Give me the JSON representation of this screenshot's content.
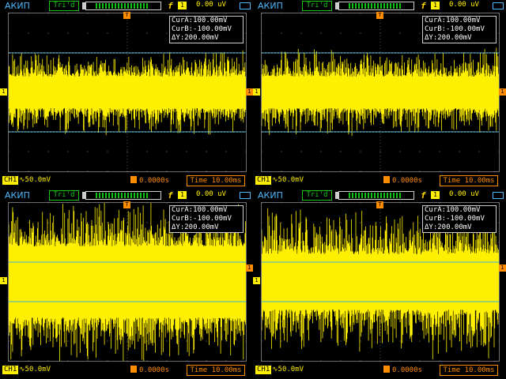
{
  "brand": "АКИП",
  "trigger_status": "Tri'd",
  "trigger_level": "0.00 uV",
  "ch1_label": "1",
  "cursor": {
    "cur_a": "CurA:100.00mV",
    "cur_b": "CurB:-100.00mV",
    "delta_y": "ΔY:200.00mV"
  },
  "bottom": {
    "channel": "CH1",
    "volts_div": "50.0mV",
    "trigger_delay": "0.0000s",
    "time_base": "Time 10.00ms"
  },
  "markers": {
    "trigger_marker": "T",
    "channel_marker": "1"
  },
  "panels": [
    {
      "id": "top-left",
      "noise_density": 1
    },
    {
      "id": "top-right",
      "noise_density": 1
    },
    {
      "id": "bottom-left",
      "noise_density": 2
    },
    {
      "id": "bottom-right",
      "noise_density": 3
    }
  ],
  "colors": {
    "trace": "#ffef00",
    "cursor_lines": "#3fb6d8",
    "accent_orange": "#ff8c00",
    "status_green": "#19c419",
    "brand_blue": "#4fb7ff"
  }
}
